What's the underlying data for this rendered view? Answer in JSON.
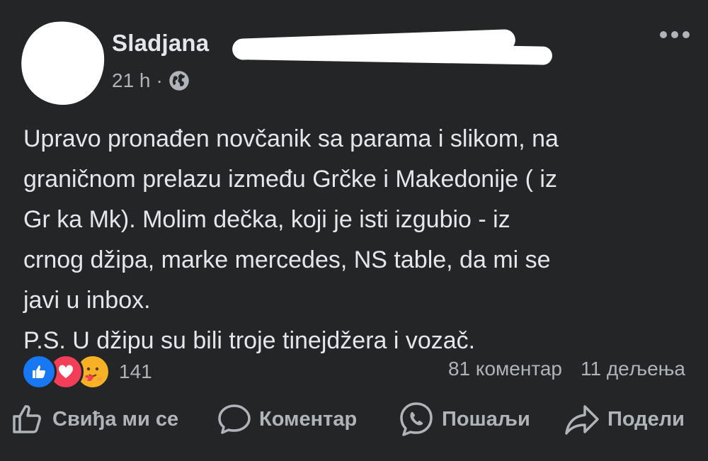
{
  "post": {
    "author_name": "Sladjana",
    "timestamp": "21 h",
    "separator": "·",
    "audience_icon": "globe-icon",
    "more_icon": "more-options-icon",
    "text": "Upravo pronađen novčanik sa parama i slikom, na\ngraničnom prelazu između Grčke i Makedonije ( iz\nGr ka Mk). Molim dečka, koji je isti izgubio - iz\ncrnog džipa, marke mercedes, NS table, da mi se\njavi u inbox.\nP.S. U džipu su bili troje tinejdžera i vozač."
  },
  "reactions": {
    "icons": [
      "like-icon",
      "love-icon",
      "care-icon"
    ],
    "count": "141",
    "comments": "81 коментар",
    "shares": "11 дељења"
  },
  "actions": {
    "like_label": "Свиђа ми се",
    "comment_label": "Коментар",
    "send_label": "Пошаљи",
    "share_label": "Подели"
  },
  "colors": {
    "background": "#242526",
    "text_primary": "#e4e6eb",
    "text_secondary": "#b0b3b8",
    "like_blue": "#1877f2",
    "love_red": "#f33e58",
    "care_yellow": "#f7b125"
  }
}
